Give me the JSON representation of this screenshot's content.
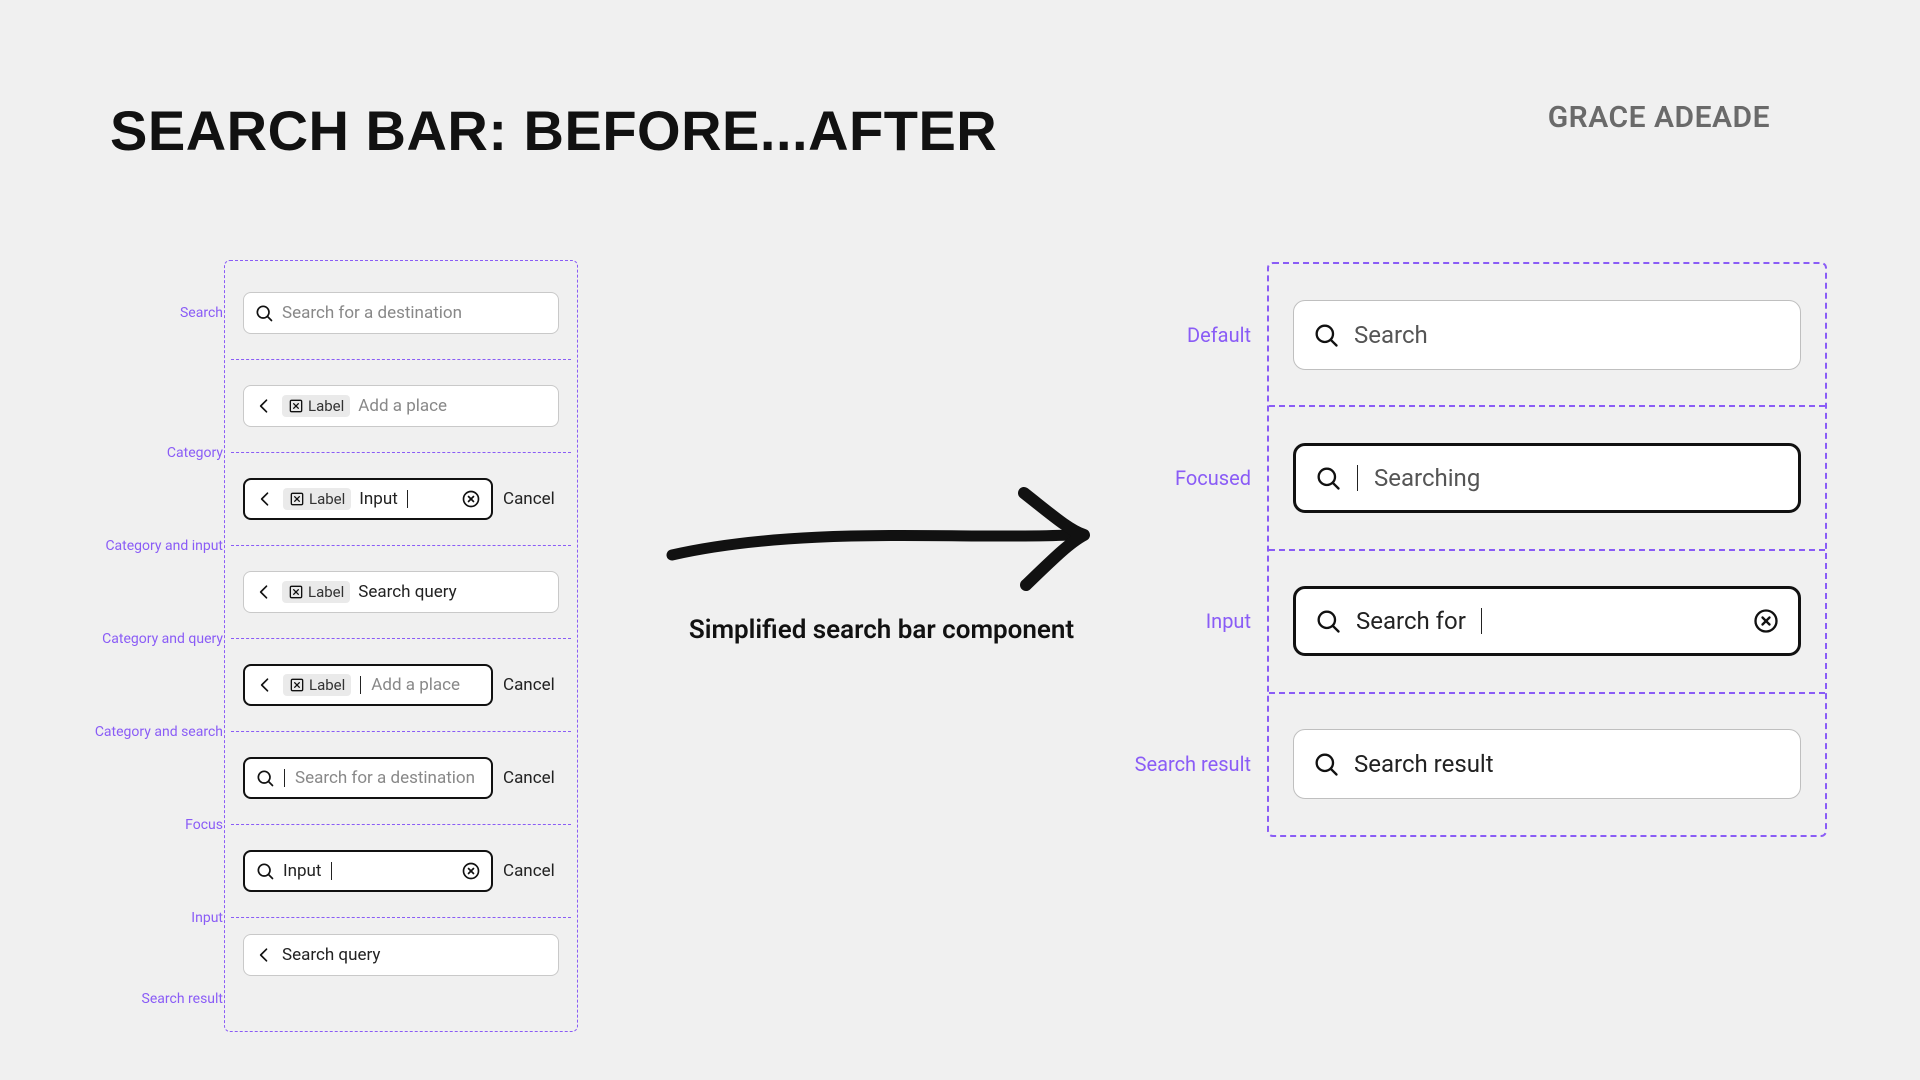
{
  "title": "SEARCH BAR: BEFORE...AFTER",
  "author": "GRACE ADEADE",
  "caption": "Simplified search bar component",
  "before": {
    "labels": {
      "search": "Search",
      "category": "Category",
      "category_input": "Category and input",
      "category_query": "Category and query",
      "category_search": "Category and search",
      "focus": "Focus",
      "input": "Input",
      "search_result": "Search result"
    },
    "chip_label": "Label",
    "cancel": "Cancel",
    "rows": {
      "r1_placeholder": "Search for a destination",
      "r2_placeholder": "Add a place",
      "r3_value": "Input",
      "r4_value": "Search query",
      "r5_placeholder": "Add a place",
      "r6_placeholder": "Search for a destination",
      "r7_value": "Input",
      "r8_value": "Search query"
    }
  },
  "after": {
    "labels": {
      "default": "Default",
      "focused": "Focused",
      "input": "Input",
      "search_result": "Search result"
    },
    "rows": {
      "r1_placeholder": "Search",
      "r2_placeholder": "Searching",
      "r3_value": "Search for",
      "r4_value": "Search result"
    }
  }
}
